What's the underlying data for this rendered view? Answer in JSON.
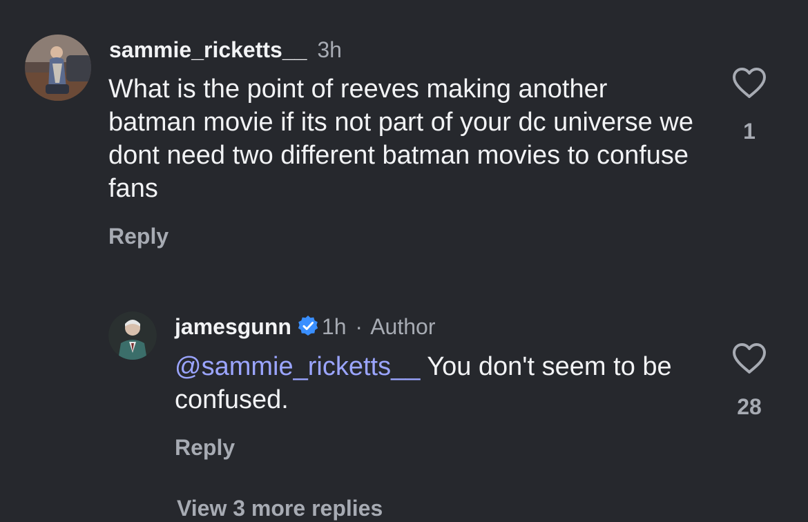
{
  "comments": [
    {
      "username": "sammie_ricketts__",
      "time": "3h",
      "author_tag": "",
      "text": "What is the point of reeves making another batman movie if its not part of  your dc universe we dont need two different batman movies to confuse fans",
      "reply_label": "Reply",
      "like_count": "1",
      "avatar_icon": "user-photo-avatar"
    }
  ],
  "replies": [
    {
      "username": "jamesgunn",
      "verified": true,
      "time": "1h",
      "separator": "·",
      "author_tag": "Author",
      "mention": "@sammie_ricketts__",
      "text": " You don't seem to be confused.",
      "reply_label": "Reply",
      "like_count": "28",
      "avatar_icon": "user-photo-avatar"
    }
  ],
  "view_more_label": "View 3 more replies",
  "colors": {
    "background": "#26282d",
    "text": "#f2f3f5",
    "muted": "#a7abb3",
    "mention": "#9ba5ff",
    "verified_badge": "#3a8fff"
  },
  "icons": {
    "like": "heart-outline-icon",
    "verified": "verified-badge-icon"
  }
}
